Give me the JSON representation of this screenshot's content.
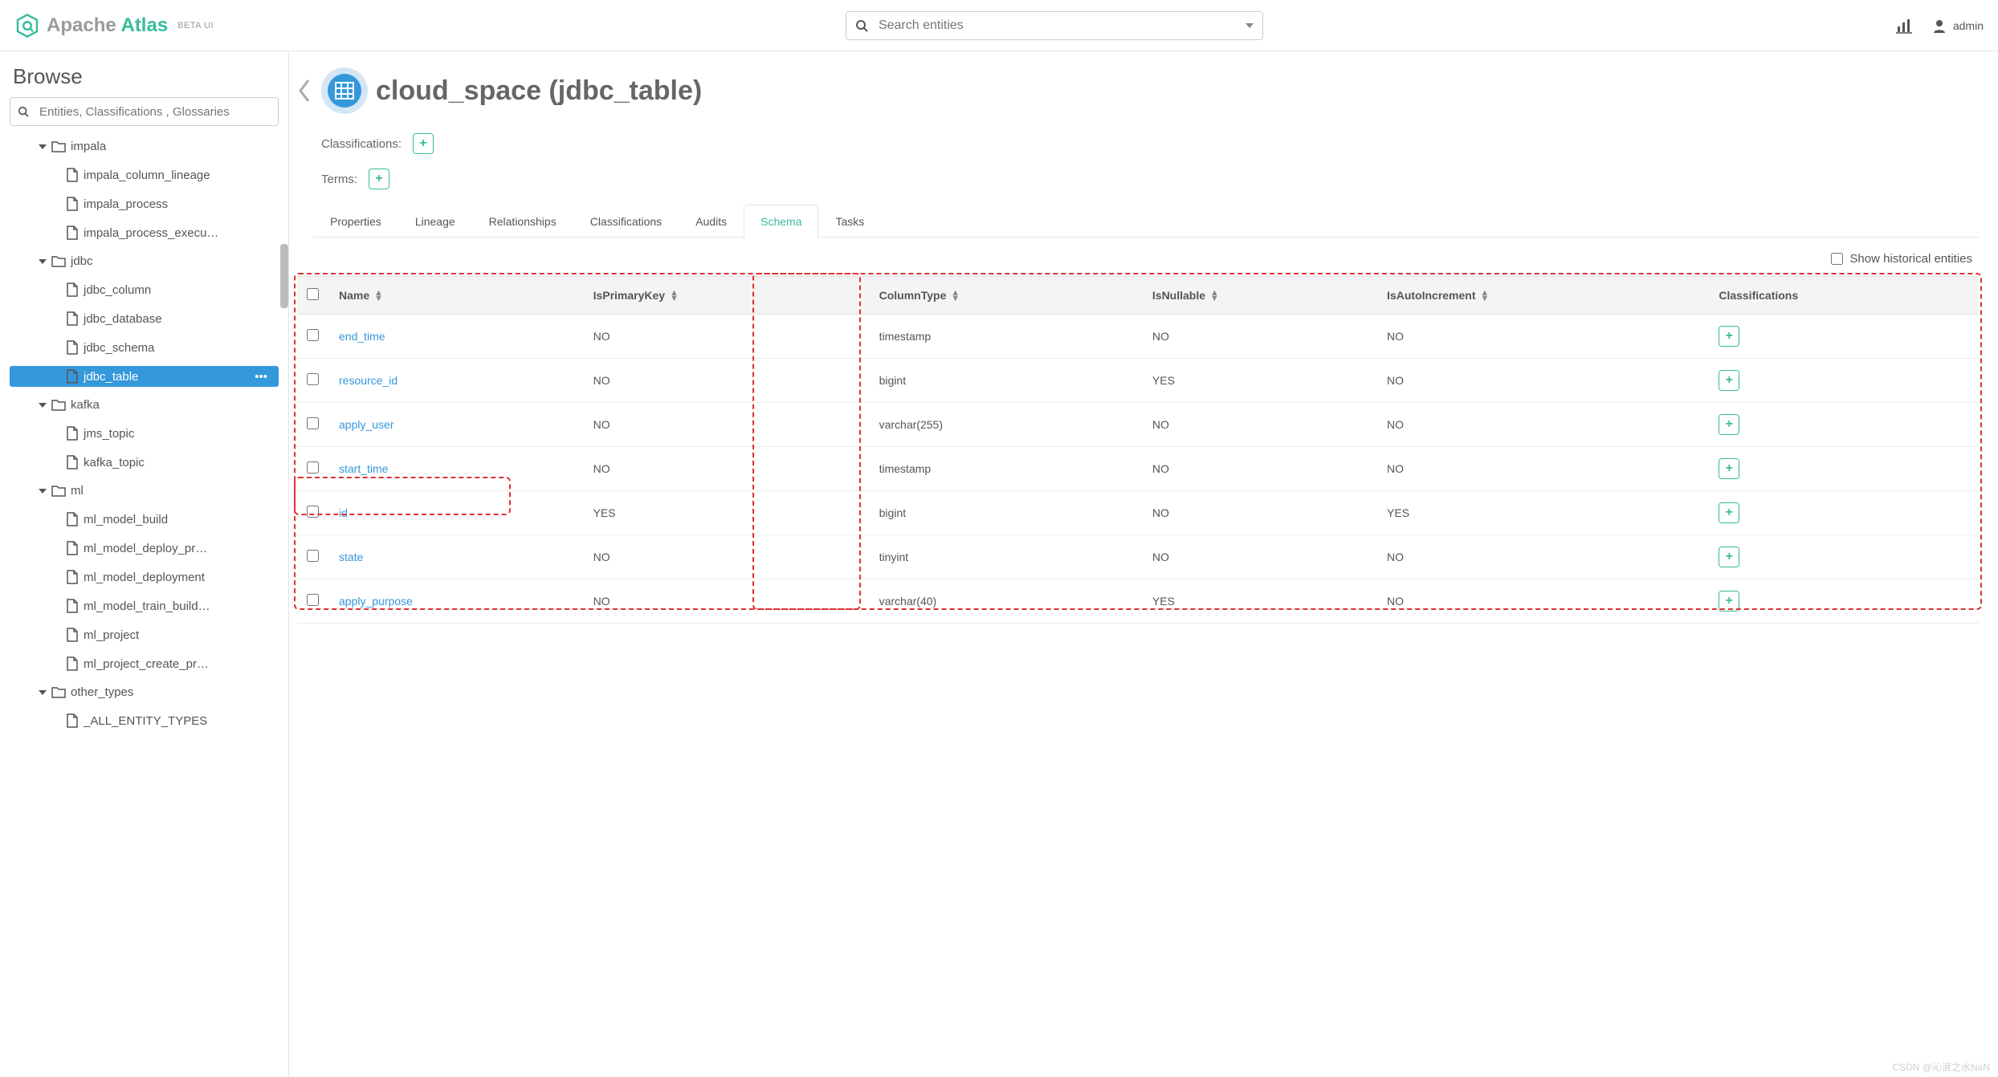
{
  "header": {
    "brand_a": "Apache",
    "brand_b": "Atlas",
    "beta": "BETA UI",
    "search_placeholder": "Search entities",
    "user": "admin"
  },
  "sidebar": {
    "title": "Browse",
    "search_placeholder": "Entities, Classifications , Glossaries",
    "tree": [
      {
        "level": 1,
        "type": "folder",
        "label": "impala",
        "caret": "down"
      },
      {
        "level": 2,
        "type": "file",
        "label": "impala_column_lineage"
      },
      {
        "level": 2,
        "type": "file",
        "label": "impala_process"
      },
      {
        "level": 2,
        "type": "file",
        "label": "impala_process_execu…"
      },
      {
        "level": 1,
        "type": "folder",
        "label": "jdbc",
        "caret": "down"
      },
      {
        "level": 2,
        "type": "file",
        "label": "jdbc_column"
      },
      {
        "level": 2,
        "type": "file",
        "label": "jdbc_database"
      },
      {
        "level": 2,
        "type": "file",
        "label": "jdbc_schema"
      },
      {
        "level": 2,
        "type": "file",
        "label": "jdbc_table",
        "active": true,
        "more": "•••"
      },
      {
        "level": 1,
        "type": "folder",
        "label": "kafka",
        "caret": "down"
      },
      {
        "level": 2,
        "type": "file",
        "label": "jms_topic"
      },
      {
        "level": 2,
        "type": "file",
        "label": "kafka_topic"
      },
      {
        "level": 1,
        "type": "folder",
        "label": "ml",
        "caret": "down"
      },
      {
        "level": 2,
        "type": "file",
        "label": "ml_model_build"
      },
      {
        "level": 2,
        "type": "file",
        "label": "ml_model_deploy_pr…"
      },
      {
        "level": 2,
        "type": "file",
        "label": "ml_model_deployment"
      },
      {
        "level": 2,
        "type": "file",
        "label": "ml_model_train_build…"
      },
      {
        "level": 2,
        "type": "file",
        "label": "ml_project"
      },
      {
        "level": 2,
        "type": "file",
        "label": "ml_project_create_pr…"
      },
      {
        "level": 1,
        "type": "folder",
        "label": "other_types",
        "caret": "down"
      },
      {
        "level": 2,
        "type": "file",
        "label": "_ALL_ENTITY_TYPES"
      }
    ]
  },
  "entity": {
    "title": "cloud_space (jdbc_table)",
    "classifications_label": "Classifications:",
    "terms_label": "Terms:"
  },
  "tabs": [
    "Properties",
    "Lineage",
    "Relationships",
    "Classifications",
    "Audits",
    "Schema",
    "Tasks"
  ],
  "active_tab": "Schema",
  "hist_label": "Show historical entities",
  "table": {
    "headers": [
      "Name",
      "IsPrimaryKey",
      "ColumnType",
      "IsNullable",
      "IsAutoIncrement",
      "Classifications"
    ],
    "rows": [
      {
        "name": "end_time",
        "pk": "NO",
        "ctype": "timestamp",
        "nullable": "NO",
        "auto": "NO"
      },
      {
        "name": "resource_id",
        "pk": "NO",
        "ctype": "bigint",
        "nullable": "YES",
        "auto": "NO"
      },
      {
        "name": "apply_user",
        "pk": "NO",
        "ctype": "varchar(255)",
        "nullable": "NO",
        "auto": "NO"
      },
      {
        "name": "start_time",
        "pk": "NO",
        "ctype": "timestamp",
        "nullable": "NO",
        "auto": "NO"
      },
      {
        "name": "id",
        "pk": "YES",
        "ctype": "bigint",
        "nullable": "NO",
        "auto": "YES"
      },
      {
        "name": "state",
        "pk": "NO",
        "ctype": "tinyint",
        "nullable": "NO",
        "auto": "NO"
      },
      {
        "name": "apply_purpose",
        "pk": "NO",
        "ctype": "varchar(40)",
        "nullable": "YES",
        "auto": "NO"
      }
    ]
  },
  "watermark": "CSDN @沁泯之水NaN"
}
